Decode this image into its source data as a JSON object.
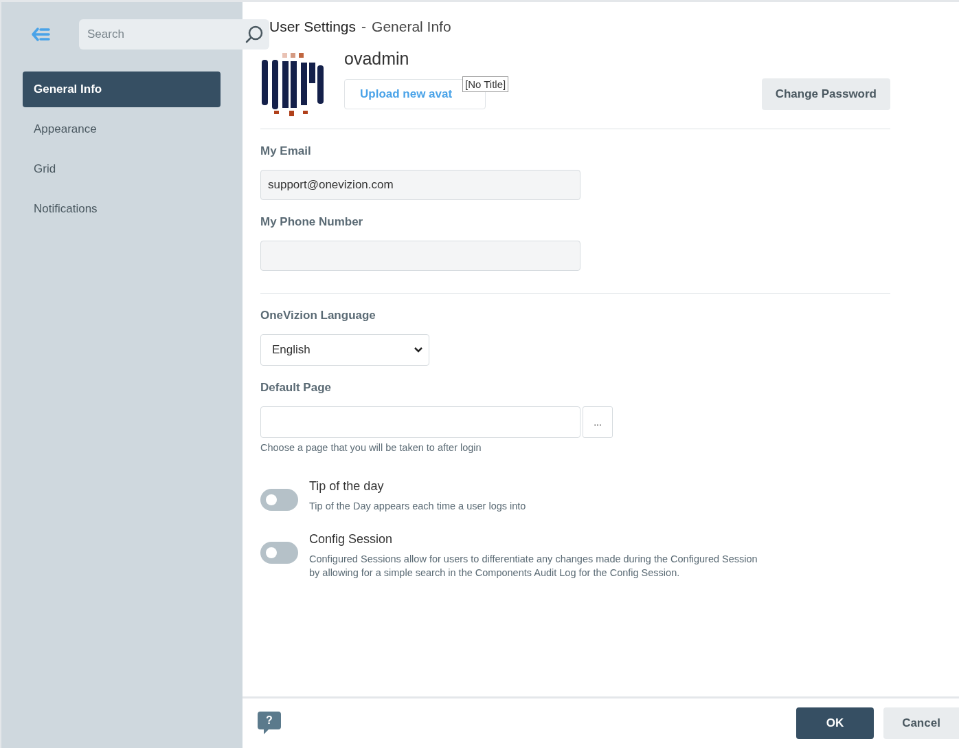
{
  "sidebar": {
    "search": {
      "placeholder": "Search"
    },
    "items": [
      {
        "label": "General Info",
        "selected": true
      },
      {
        "label": "Appearance",
        "selected": false
      },
      {
        "label": "Grid",
        "selected": false
      },
      {
        "label": "Notifications",
        "selected": false
      }
    ]
  },
  "header": {
    "title": "User Settings",
    "separator": "-",
    "subtitle": "General Info"
  },
  "profile": {
    "username": "ovadmin",
    "upload_button": "Upload new avat",
    "tooltip": "[No Title]",
    "change_password": "Change Password"
  },
  "fields": [
    {
      "kind": "text",
      "label": "My Email",
      "value": "support@onevizion.com"
    },
    {
      "kind": "text",
      "label": "My Phone Number"
    },
    {
      "kind": "divider"
    },
    {
      "kind": "select",
      "label": "OneVizion Language",
      "value": "English"
    },
    {
      "kind": "picker",
      "label": "Default Page",
      "button": "...",
      "hint": "Choose a page that you will be taken to after login"
    }
  ],
  "toggles": [
    {
      "label": "Tip of the day",
      "description": "Tip of the Day appears each time a user logs into",
      "on": false
    },
    {
      "label": "Config Session",
      "description": "Configured Sessions allow for users to differentiate any changes made during the Configured Session\nby allowing for a simple search in the Components Audit Log for the Config Session.",
      "on": false
    }
  ],
  "footer": {
    "help": "?",
    "ok": "OK",
    "cancel": "Cancel"
  }
}
